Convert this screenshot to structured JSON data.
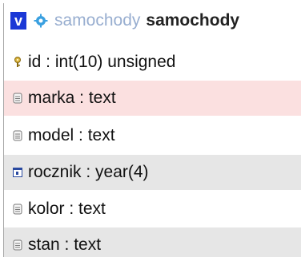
{
  "header": {
    "toggle_label": "v",
    "database": "samochody",
    "table": "samochody",
    "icon": "settings-icon"
  },
  "columns": [
    {
      "label": "id : int(10) unsigned",
      "icon": "primary-key-icon"
    },
    {
      "label": "marka : text",
      "icon": "text-column-icon"
    },
    {
      "label": "model : text",
      "icon": "text-column-icon"
    },
    {
      "label": "rocznik : year(4)",
      "icon": "date-column-icon"
    },
    {
      "label": "kolor : text",
      "icon": "text-column-icon"
    },
    {
      "label": "stan : text",
      "icon": "text-column-icon"
    }
  ],
  "colors": {
    "toggle_bg": "#1b38d6",
    "highlight_row": "#fbe0e0",
    "alt_row": "#e6e6e6",
    "db_name": "#98aed0"
  }
}
